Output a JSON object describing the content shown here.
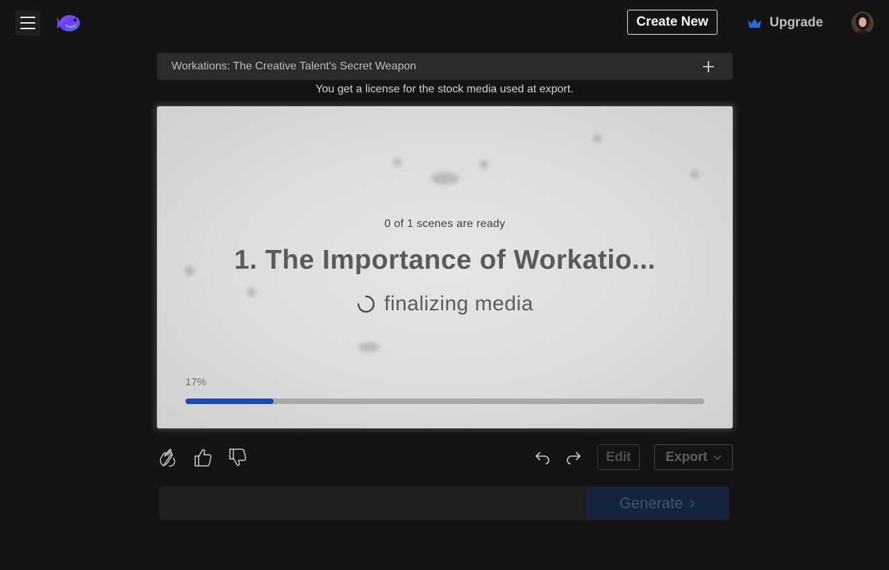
{
  "header": {
    "menu_icon": "hamburger-icon",
    "logo_icon": "fish-logo-icon",
    "create_new_label": "Create New",
    "upgrade_label": "Upgrade",
    "upgrade_icon": "crown-icon",
    "crown_color": "#2f6bd8"
  },
  "project": {
    "title": "Workations: The Creative Talent's Secret Weapon",
    "add_icon": "plus-icon",
    "license_note": "You get a license for the stock media used at export."
  },
  "preview": {
    "scenes_ready": "0 of 1 scenes are ready",
    "scene_title": "1. The Importance of Workatio...",
    "status": "finalizing media",
    "progress_label": "17%",
    "progress_value": 0.17,
    "progress_color": "#1f4aa8"
  },
  "toolbar": {
    "love_icon": "clapping-hands-icon",
    "like_icon": "thumbs-up-icon",
    "dislike_icon": "thumbs-down-icon",
    "undo_icon": "undo-icon",
    "redo_icon": "redo-icon",
    "edit_label": "Edit",
    "export_label": "Export"
  },
  "generate": {
    "input_value": "",
    "button_label": "Generate"
  }
}
